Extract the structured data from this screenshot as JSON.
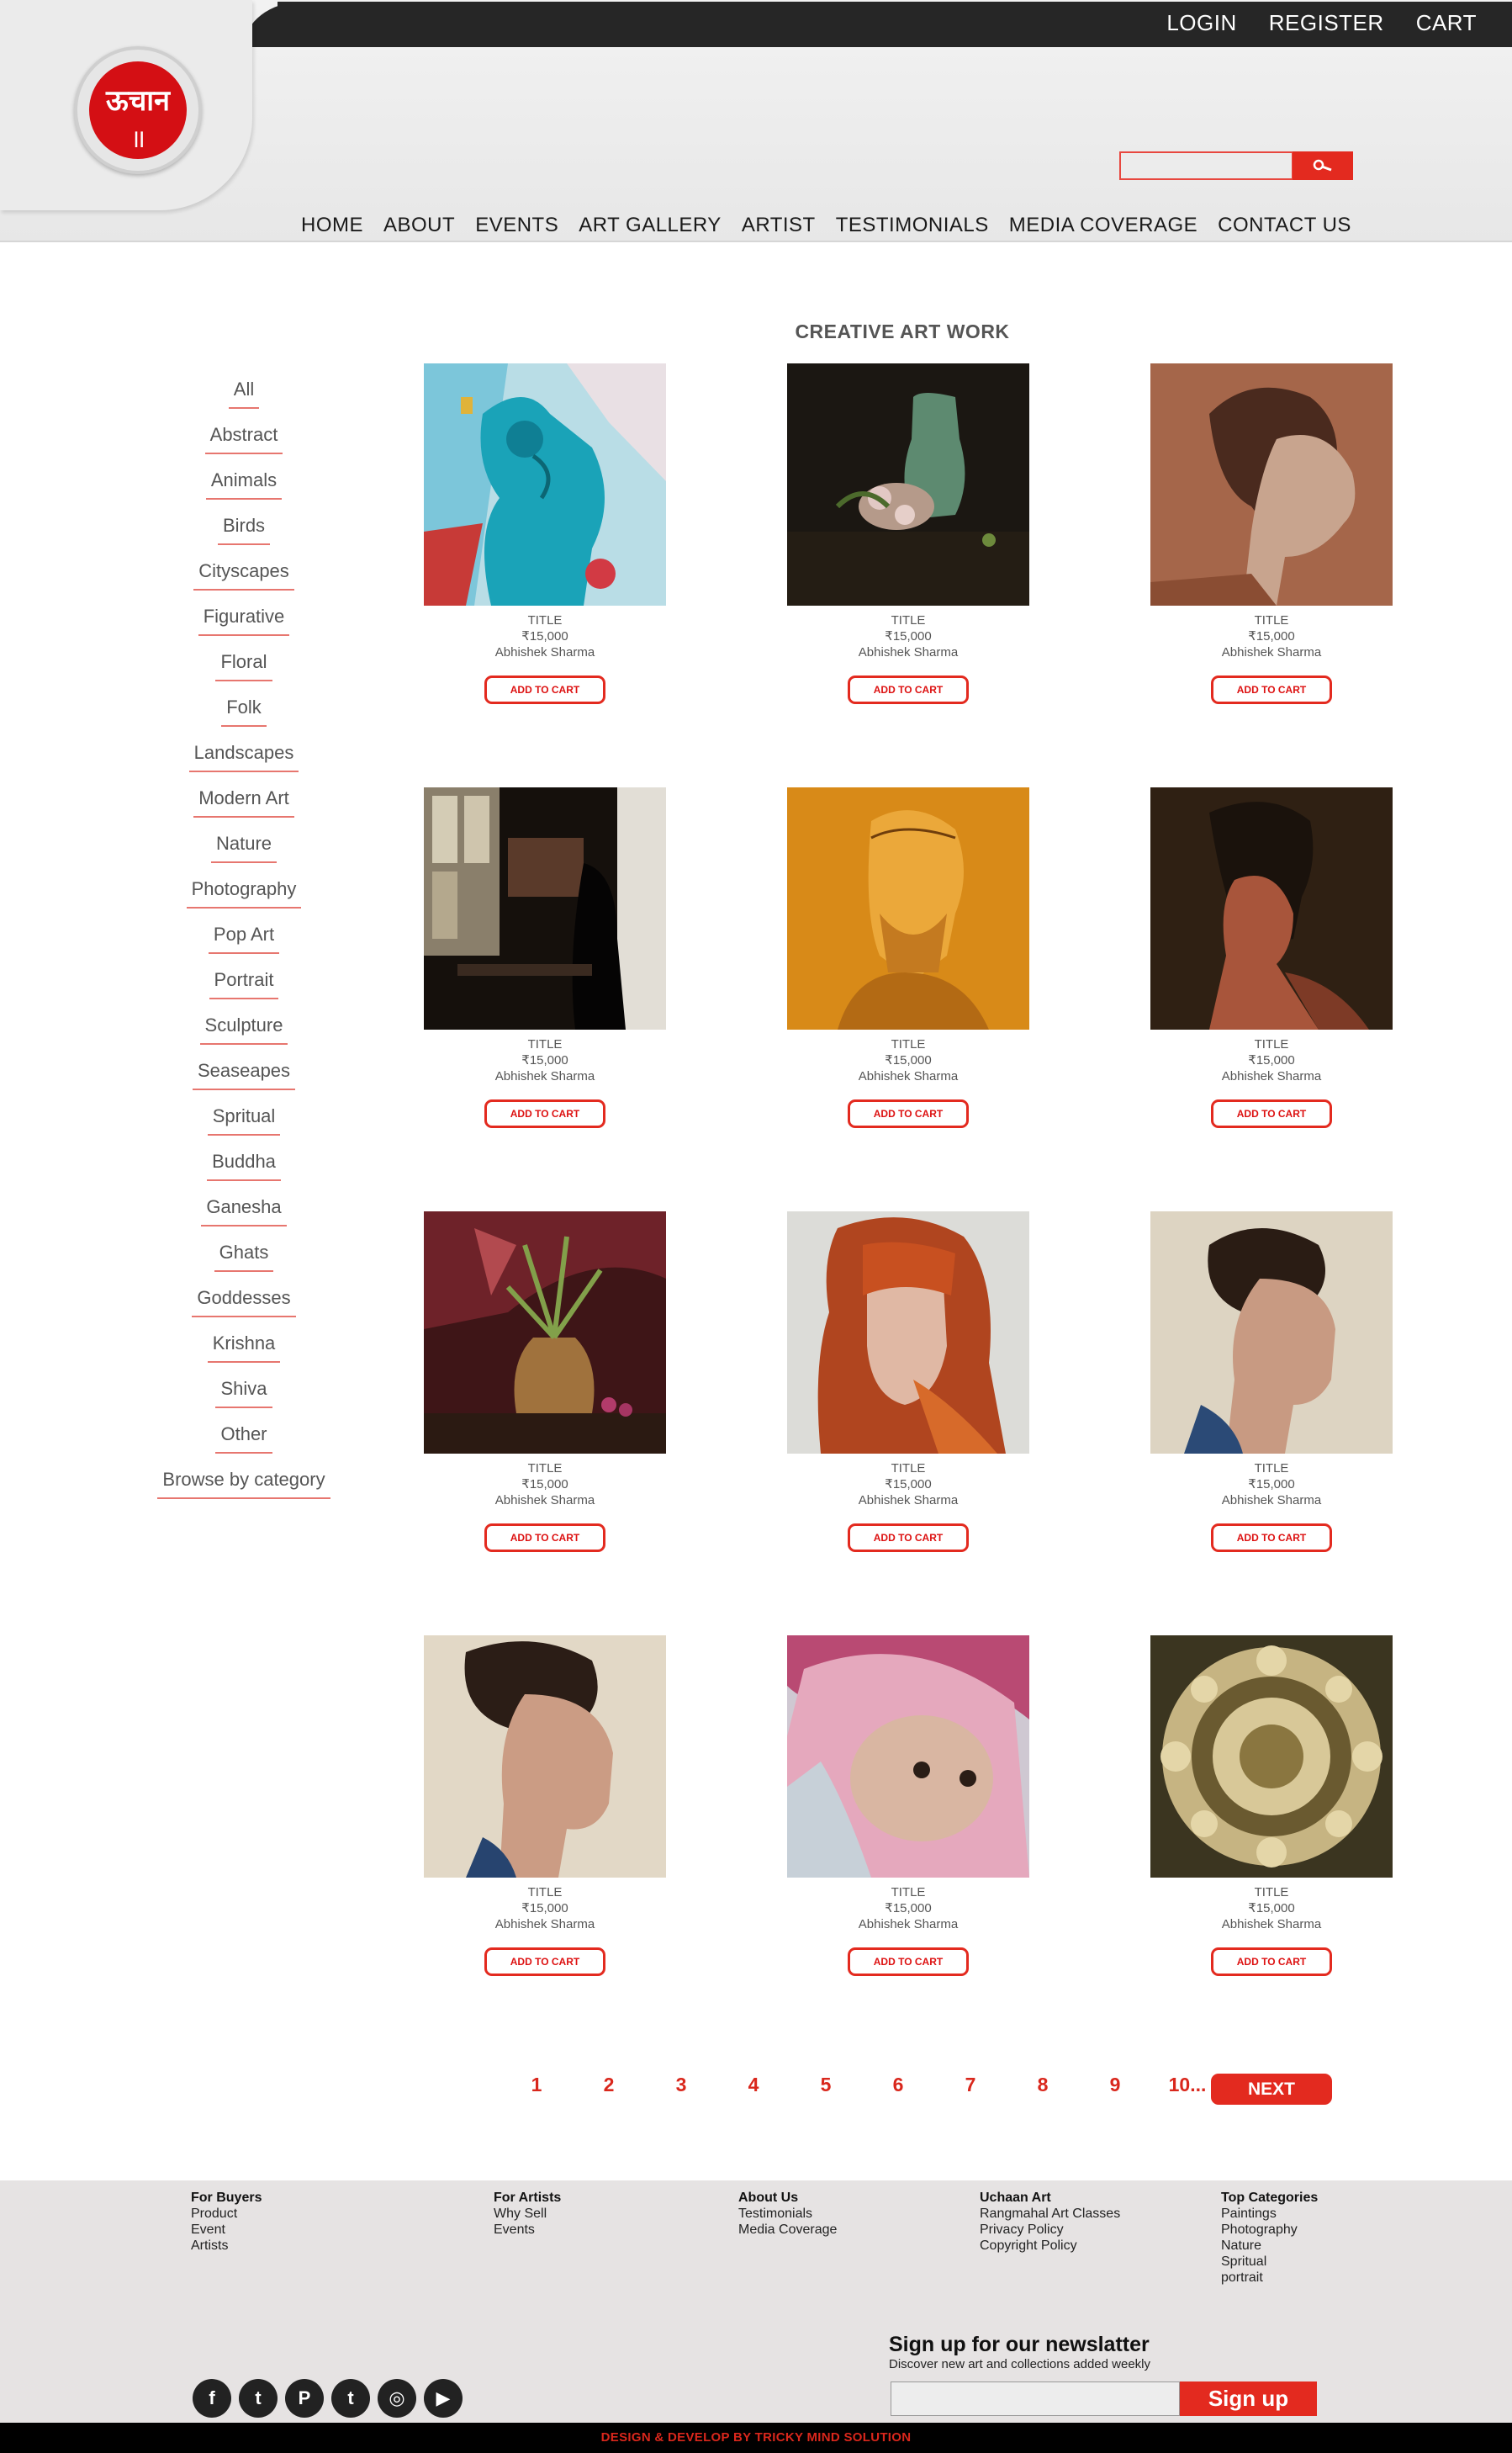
{
  "header": {
    "top_links": [
      "LOGIN",
      "REGISTER",
      "CART"
    ],
    "logo_text": "ऊचान",
    "logo_mark": "॥",
    "search_placeholder": "",
    "nav": [
      "HOME",
      "ABOUT",
      "EVENTS",
      "ART GALLERY",
      "ARTIST",
      "TESTIMONIALS",
      "MEDIA COVERAGE",
      "CONTACT US"
    ]
  },
  "page_title": "CREATIVE ART WORK",
  "categories": [
    "All",
    "Abstract",
    "Animals",
    "Birds",
    "Cityscapes",
    "Figurative",
    "Floral",
    "Folk",
    "Landscapes",
    "Modern Art",
    "Nature",
    "Photography",
    "Pop Art",
    "Portrait",
    "Sculpture",
    "Seaseapes",
    "Spritual",
    "Buddha",
    "Ganesha",
    "Ghats",
    "Goddesses",
    "Krishna",
    "Shiva",
    "Other",
    "Browse by category"
  ],
  "products": [
    {
      "title": "TITLE",
      "price": "₹15,000",
      "artist": "Abhishek Sharma",
      "button": "ADD TO CART",
      "image": "blue-abstract-figure"
    },
    {
      "title": "TITLE",
      "price": "₹15,000",
      "artist": "Abhishek Sharma",
      "button": "ADD TO CART",
      "image": "still-life-vase"
    },
    {
      "title": "TITLE",
      "price": "₹15,000",
      "artist": "Abhishek Sharma",
      "button": "ADD TO CART",
      "image": "woman-profile-sketch"
    },
    {
      "title": "TITLE",
      "price": "₹15,000",
      "artist": "Abhishek Sharma",
      "button": "ADD TO CART",
      "image": "cafe-interior"
    },
    {
      "title": "TITLE",
      "price": "₹15,000",
      "artist": "Abhishek Sharma",
      "button": "ADD TO CART",
      "image": "old-man-sketch"
    },
    {
      "title": "TITLE",
      "price": "₹15,000",
      "artist": "Abhishek Sharma",
      "button": "ADD TO CART",
      "image": "man-profile-portrait"
    },
    {
      "title": "TITLE",
      "price": "₹15,000",
      "artist": "Abhishek Sharma",
      "button": "ADD TO CART",
      "image": "plant-in-pot"
    },
    {
      "title": "TITLE",
      "price": "₹15,000",
      "artist": "Abhishek Sharma",
      "button": "ADD TO CART",
      "image": "red-haired-girl"
    },
    {
      "title": "TITLE",
      "price": "₹15,000",
      "artist": "Abhishek Sharma",
      "button": "ADD TO CART",
      "image": "woman-profile-painting"
    },
    {
      "title": "TITLE",
      "price": "₹15,000",
      "artist": "Abhishek Sharma",
      "button": "ADD TO CART",
      "image": "woman-profile-painting-2"
    },
    {
      "title": "TITLE",
      "price": "₹15,000",
      "artist": "Abhishek Sharma",
      "button": "ADD TO CART",
      "image": "baby-in-blanket"
    },
    {
      "title": "TITLE",
      "price": "₹15,000",
      "artist": "Abhishek Sharma",
      "button": "ADD TO CART",
      "image": "gold-mandala"
    }
  ],
  "pagination": {
    "pages": [
      "1",
      "2",
      "3",
      "4",
      "5",
      "6",
      "7",
      "8",
      "9",
      "10..."
    ],
    "next": "NEXT"
  },
  "footer": {
    "columns": [
      {
        "heading": "For Buyers",
        "links": [
          "Product",
          "Event",
          "Artists"
        ]
      },
      {
        "heading": "For Artists",
        "links": [
          "Why Sell",
          "Events"
        ]
      },
      {
        "heading": "About Us",
        "links": [
          "Testimonials",
          "Media Coverage"
        ]
      },
      {
        "heading": "Uchaan Art",
        "links": [
          "Rangmahal Art Classes",
          "Privacy Policy",
          "Copyright Policy"
        ]
      },
      {
        "heading": "Top Categories",
        "links": [
          "Paintings",
          "Photography",
          "Nature",
          "Spritual",
          "portrait"
        ]
      }
    ],
    "newsletter": {
      "title": "Sign up for our newslatter",
      "subtitle": "Discover new art and collections added weekly",
      "button": "Sign up",
      "placeholder": ""
    },
    "socials": [
      {
        "name": "facebook-icon",
        "glyph": "f"
      },
      {
        "name": "twitter-icon",
        "glyph": "t"
      },
      {
        "name": "pinterest-icon",
        "glyph": "P"
      },
      {
        "name": "tumblr-icon",
        "glyph": "t"
      },
      {
        "name": "instagram-icon",
        "glyph": "◎"
      },
      {
        "name": "youtube-icon",
        "glyph": "▶"
      }
    ],
    "credit": "DESIGN & DEVELOP BY TRICKY MIND SOLUTION"
  },
  "colors": {
    "accent": "#e32a1f",
    "topbar": "#262626",
    "footer_bg": "#e6e3e3"
  }
}
